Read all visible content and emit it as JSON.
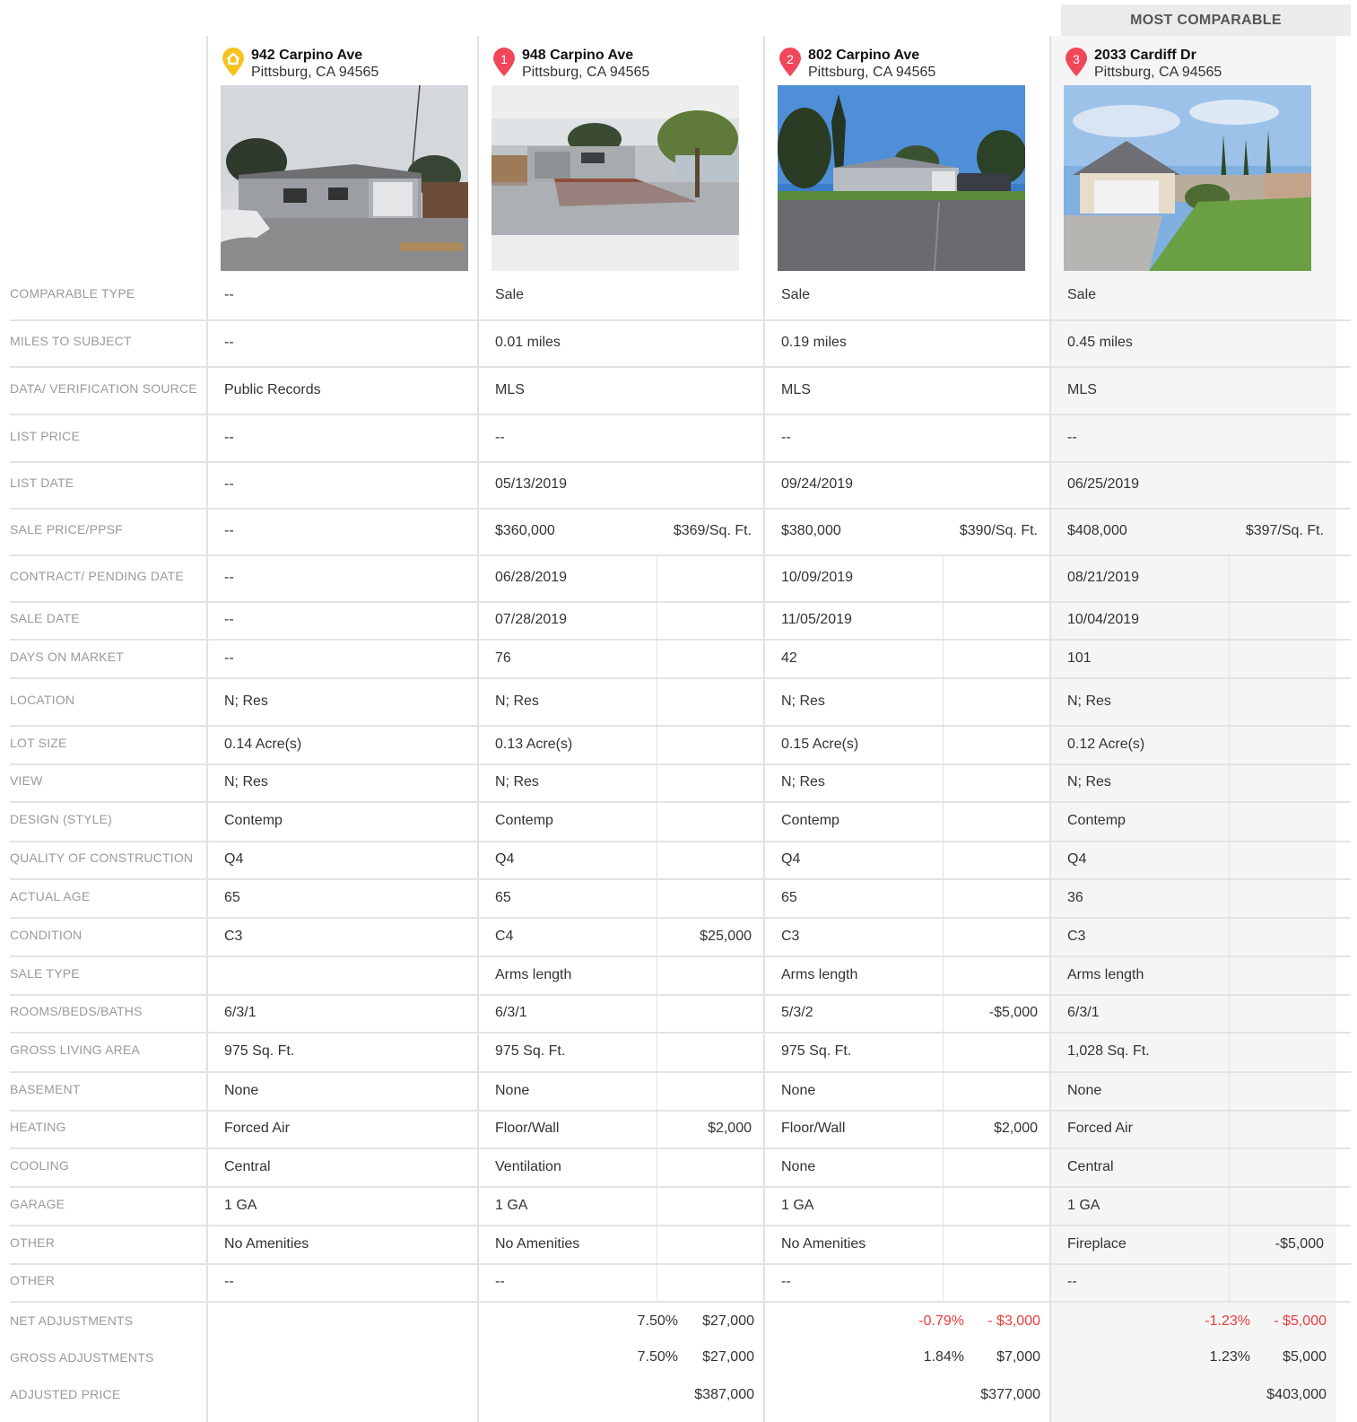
{
  "header": {
    "most_comparable": "MOST COMPARABLE"
  },
  "properties": [
    {
      "address": "942 Carpino Ave",
      "city": "Pittsburg, CA 94565",
      "pin": "home-icon",
      "photo": "house-photo"
    },
    {
      "address": "948 Carpino Ave",
      "city": "Pittsburg, CA 94565",
      "pin": "1",
      "photo": "house-photo"
    },
    {
      "address": "802 Carpino Ave",
      "city": "Pittsburg, CA 94565",
      "pin": "2",
      "photo": "house-photo"
    },
    {
      "address": "2033 Cardiff Dr",
      "city": "Pittsburg, CA 94565",
      "pin": "3",
      "photo": "house-photo"
    }
  ],
  "rows": [
    {
      "label": "COMPARABLE TYPE",
      "values": [
        "--",
        "Sale",
        "Sale",
        "Sale"
      ]
    },
    {
      "label": "MILES TO SUBJECT",
      "values": [
        "--",
        "0.01 miles",
        "0.19 miles",
        "0.45 miles"
      ]
    },
    {
      "label": "DATA/ VERIFICATION SOURCE",
      "values": [
        "Public Records",
        "MLS",
        "MLS",
        "MLS"
      ]
    },
    {
      "label": "LIST PRICE",
      "values": [
        "--",
        "--",
        "--",
        "--"
      ]
    },
    {
      "label": "LIST DATE",
      "values": [
        "--",
        "05/13/2019",
        "09/24/2019",
        "06/25/2019"
      ]
    },
    {
      "label": "SALE PRICE/PPSF",
      "values": [
        "--",
        "$360,000",
        "$380,000",
        "$408,000"
      ],
      "adj": [
        "",
        "$369/Sq. Ft.",
        "$390/Sq. Ft.",
        "$397/Sq. Ft."
      ]
    },
    {
      "label": "CONTRACT/ PENDING DATE",
      "values": [
        "--",
        "06/28/2019",
        "10/09/2019",
        "08/21/2019"
      ]
    },
    {
      "label": "SALE DATE",
      "values": [
        "--",
        "07/28/2019",
        "11/05/2019",
        "10/04/2019"
      ]
    },
    {
      "label": "DAYS ON MARKET",
      "values": [
        "--",
        "76",
        "42",
        "101"
      ]
    },
    {
      "label": "LOCATION",
      "values": [
        "N; Res",
        "N; Res",
        "N; Res",
        "N; Res"
      ]
    },
    {
      "label": "LOT SIZE",
      "values": [
        "0.14 Acre(s)",
        "0.13 Acre(s)",
        "0.15 Acre(s)",
        "0.12 Acre(s)"
      ]
    },
    {
      "label": "VIEW",
      "values": [
        "N; Res",
        "N; Res",
        "N; Res",
        "N; Res"
      ]
    },
    {
      "label": "DESIGN (STYLE)",
      "values": [
        "Contemp",
        "Contemp",
        "Contemp",
        "Contemp"
      ]
    },
    {
      "label": "QUALITY OF CONSTRUCTION",
      "values": [
        "Q4",
        "Q4",
        "Q4",
        "Q4"
      ]
    },
    {
      "label": "ACTUAL AGE",
      "values": [
        "65",
        "65",
        "65",
        "36"
      ]
    },
    {
      "label": "CONDITION",
      "values": [
        "C3",
        "C4",
        "C3",
        "C3"
      ],
      "adj": [
        "",
        "$25,000",
        "",
        ""
      ]
    },
    {
      "label": "SALE TYPE",
      "values": [
        "",
        "Arms length",
        "Arms length",
        "Arms length"
      ]
    },
    {
      "label": "ROOMS/BEDS/BATHS",
      "values": [
        "6/3/1",
        "6/3/1",
        "5/3/2",
        "6/3/1"
      ],
      "adj": [
        "",
        "",
        "-$5,000",
        ""
      ]
    },
    {
      "label": "GROSS LIVING AREA",
      "values": [
        "975 Sq. Ft.",
        "975 Sq. Ft.",
        "975 Sq. Ft.",
        "1,028 Sq. Ft."
      ]
    },
    {
      "label": "BASEMENT",
      "values": [
        "None",
        "None",
        "None",
        "None"
      ]
    },
    {
      "label": "HEATING",
      "values": [
        "Forced Air",
        "Floor/Wall",
        "Floor/Wall",
        "Forced Air"
      ],
      "adj": [
        "",
        "$2,000",
        "$2,000",
        ""
      ]
    },
    {
      "label": "COOLING",
      "values": [
        "Central",
        "Ventilation",
        "None",
        "Central"
      ]
    },
    {
      "label": "GARAGE",
      "values": [
        "1 GA",
        "1 GA",
        "1 GA",
        "1 GA"
      ]
    },
    {
      "label": "OTHER",
      "values": [
        "No Amenities",
        "No Amenities",
        "No Amenities",
        "Fireplace"
      ],
      "adj": [
        "",
        "",
        "",
        "-$5,000"
      ]
    },
    {
      "label": "OTHER",
      "values": [
        "--",
        "--",
        "--",
        "--"
      ]
    }
  ],
  "summary": {
    "net_label": "NET ADJUSTMENTS",
    "gross_label": "GROSS ADJUSTMENTS",
    "adjusted_label": "ADJUSTED PRICE",
    "net": [
      {
        "pct": "7.50%",
        "amt": "$27,000"
      },
      {
        "pct": "-0.79%",
        "amt": "- $3,000"
      },
      {
        "pct": "-1.23%",
        "amt": "- $5,000"
      }
    ],
    "gross": [
      {
        "pct": "7.50%",
        "amt": "$27,000"
      },
      {
        "pct": "1.84%",
        "amt": "$7,000"
      },
      {
        "pct": "1.23%",
        "amt": "$5,000"
      }
    ],
    "adjusted": [
      "$387,000",
      "$377,000",
      "$403,000"
    ]
  },
  "colors": {
    "pin_red": "#f0475a",
    "pin_home": "#f7c21e",
    "negative": "#ee3b3b",
    "highlight": "#f5f5f5"
  }
}
